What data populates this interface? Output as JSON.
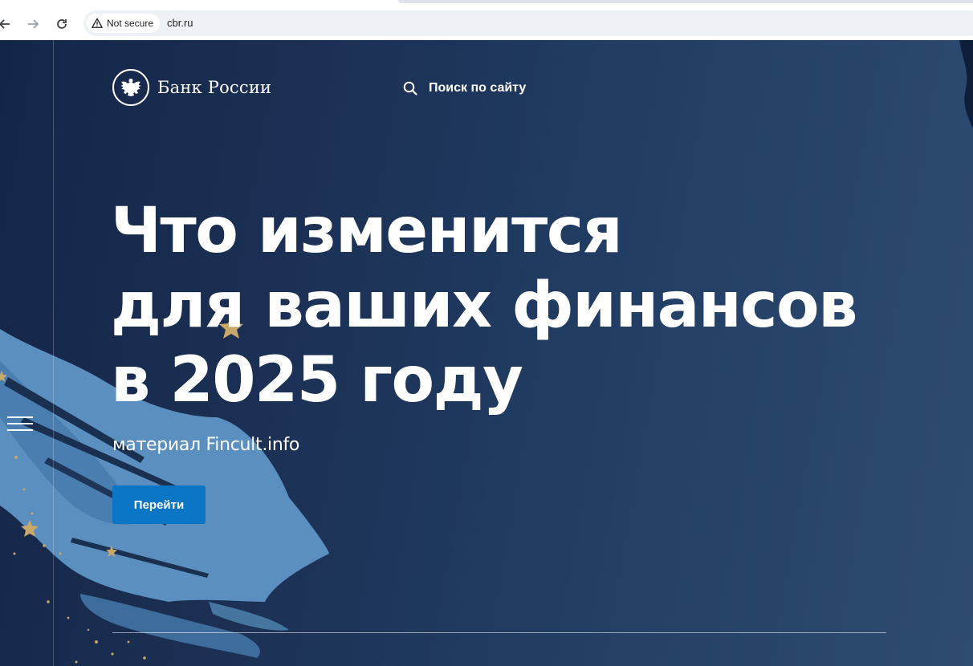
{
  "browser": {
    "security_label": "Not secure",
    "url": "cbr.ru",
    "icons": [
      "back-arrow-icon",
      "forward-arrow-icon",
      "reload-icon",
      "warning-icon"
    ]
  },
  "header": {
    "logo_text": "Банк России",
    "search_label": "Поиск по сайту"
  },
  "hero": {
    "headline_lines": [
      "Что изменится",
      "для ваших финансов",
      "в 2025 году"
    ],
    "subtitle": "материал Fincult.info",
    "cta_label": "Перейти"
  },
  "colors": {
    "background": "#1b3054",
    "brush_stroke": "#5a8fc0",
    "stars": "#c9a96a",
    "button": "#0b76c6"
  }
}
